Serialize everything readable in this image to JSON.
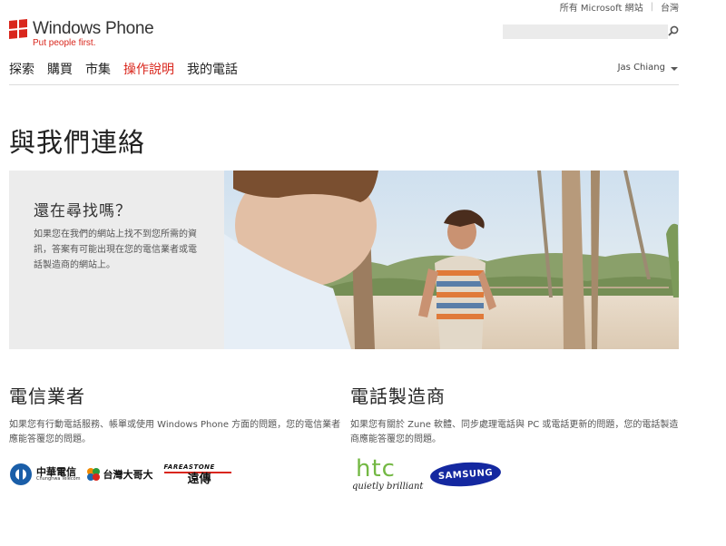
{
  "top_links": {
    "ms_sites": "所有 Microsoft 網站",
    "region": "台灣"
  },
  "logo": {
    "name": "Windows Phone",
    "tagline": "Put people first."
  },
  "search": {
    "placeholder": ""
  },
  "nav": {
    "items": [
      {
        "label": "探索"
      },
      {
        "label": "購買"
      },
      {
        "label": "市集"
      },
      {
        "label": "操作說明",
        "active": true
      },
      {
        "label": "我的電話"
      }
    ]
  },
  "user": {
    "name": "Jas Chiang"
  },
  "page": {
    "title": "與我們連絡"
  },
  "hero": {
    "heading": "還在尋找嗎？",
    "text": "如果您在我們的網站上找不到您所需的資訊，答案有可能出現在您的電信業者或電話製造商的網站上。"
  },
  "carriers": {
    "heading": "電信業者",
    "text": "如果您有行動電話服務、帳單或使用 Windows Phone 方面的問題，您的電信業者應能答覆您的問題。",
    "logos": {
      "cht_name": "中華電信",
      "cht_en": "Chunghwa Telecom",
      "twm_name": "台灣大哥大",
      "fet_en": "FAREASTONE",
      "fet_zh": "遠傳"
    }
  },
  "manufacturers": {
    "heading": "電話製造商",
    "text": "如果您有關於 Zune 軟體、同步處理電話與 PC 或電話更新的問題，您的電話製造商應能答覆您的問題。",
    "logos": {
      "htc_name": "htc",
      "htc_tagline": "quietly brilliant",
      "samsung_name": "SAMSUNG"
    }
  },
  "colors": {
    "accent": "#d9261c",
    "hero_panel": "#ececec",
    "htc_green": "#73b843",
    "samsung_blue": "#1428a0"
  },
  "icons": [
    "search-icon",
    "caret-down-icon",
    "windows-flag-icon"
  ]
}
